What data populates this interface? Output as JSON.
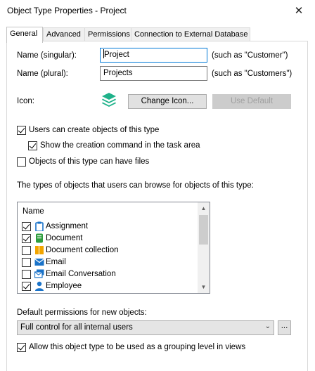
{
  "window": {
    "title": "Object Type Properties - Project",
    "close_glyph": "✕"
  },
  "tabs": [
    {
      "label": "General",
      "active": true
    },
    {
      "label": "Advanced",
      "active": false
    },
    {
      "label": "Permissions",
      "active": false
    },
    {
      "label": "Connection to External Database",
      "active": false
    }
  ],
  "general": {
    "name_singular": {
      "label": "Name (singular):",
      "value": "Project",
      "hint": "(such as \"Customer\")"
    },
    "name_plural": {
      "label": "Name (plural):",
      "value": "Projects",
      "hint": "(such as \"Customers\")"
    },
    "icon": {
      "label": "Icon:",
      "icon_name": "layers-stack-icon",
      "icon_color": "#1fb28a",
      "change_button": "Change Icon...",
      "default_button": "Use Default"
    },
    "options": {
      "users_can_create": {
        "label": "Users can create objects of this type",
        "checked": true
      },
      "show_creation_command": {
        "label": "Show the creation command in the task area",
        "checked": true
      },
      "can_have_files": {
        "label": "Objects of this type can have files",
        "checked": false
      }
    },
    "browse_label": "The types of objects that users can browse for objects of this type:",
    "browse_list": {
      "header": "Name",
      "items": [
        {
          "label": "Assignment",
          "checked": true,
          "icon": "clipboard-icon",
          "color": "#1a73c9"
        },
        {
          "label": "Document",
          "checked": true,
          "icon": "document-icon",
          "color": "#2e9e3e"
        },
        {
          "label": "Document collection",
          "checked": false,
          "icon": "document-collection-icon",
          "color": "#f2a500"
        },
        {
          "label": "Email",
          "checked": false,
          "icon": "email-icon",
          "color": "#1a73c9"
        },
        {
          "label": "Email Conversation",
          "checked": false,
          "icon": "email-conversation-icon",
          "color": "#1a73c9"
        },
        {
          "label": "Employee",
          "checked": true,
          "icon": "person-icon",
          "color": "#1a73c9"
        }
      ]
    },
    "permissions_label": "Default permissions for new objects:",
    "permissions_value": "Full control for all internal users",
    "permissions_browse_button": "...",
    "grouping_option": {
      "label": "Allow this object type to be used as a grouping level in views",
      "checked": true
    }
  }
}
